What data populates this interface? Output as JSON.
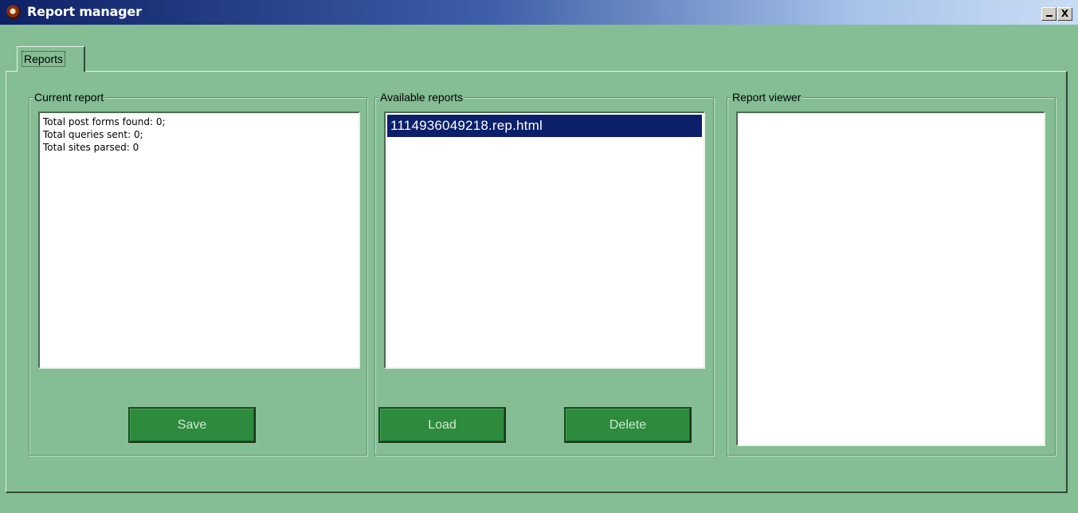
{
  "window": {
    "title": "Report manager",
    "minimize_label": "_",
    "close_label": "X"
  },
  "tabs": [
    {
      "label": "Reports",
      "active": true
    }
  ],
  "current_report": {
    "title": "Current report",
    "lines": [
      "Total post forms found: 0;",
      "Total queries sent: 0;",
      "Total sites parsed: 0"
    ],
    "save_label": "Save"
  },
  "available_reports": {
    "title": "Available reports",
    "items": [
      {
        "label": "1114936049218.rep.html",
        "selected": true
      }
    ],
    "load_label": "Load",
    "delete_label": "Delete"
  },
  "report_viewer": {
    "title": "Report viewer"
  },
  "colors": {
    "background": "#85bd94",
    "button": "#2e8a3c",
    "selection": "#0c1f6b",
    "titlebar_start": "#0e2166"
  }
}
